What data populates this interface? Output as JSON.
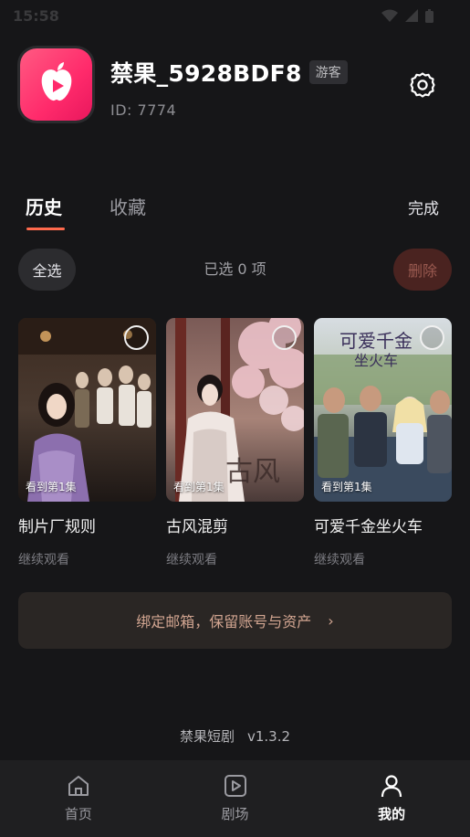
{
  "status_bar": {
    "time": "15:58"
  },
  "profile": {
    "username": "禁果_5928BDF8",
    "badge": "游客",
    "user_id": "ID:  7774"
  },
  "tabs": [
    {
      "label": "历史",
      "active": true
    },
    {
      "label": "收藏",
      "active": false
    }
  ],
  "done_label": "完成",
  "select_bar": {
    "select_all": "全选",
    "selected_count": "已选 0 项",
    "delete": "删除"
  },
  "cards": [
    {
      "title": "制片厂规则",
      "progress": "看到第1集",
      "subtitle": "继续观看"
    },
    {
      "title": "古风混剪",
      "progress": "看到第1集",
      "subtitle": "继续观看"
    },
    {
      "title": "可爱千金坐火车",
      "progress": "看到第1集",
      "subtitle": "继续观看"
    }
  ],
  "bind_email": {
    "label": "绑定邮箱，保留账号与资产",
    "arrow": "›"
  },
  "footer": {
    "app_name": "禁果短剧",
    "version": "v1.3.2"
  },
  "bottom_nav": [
    {
      "label": "首页",
      "icon": "home-icon",
      "active": false
    },
    {
      "label": "剧场",
      "icon": "play-square-icon",
      "active": false
    },
    {
      "label": "我的",
      "icon": "user-icon",
      "active": true
    }
  ],
  "colors": {
    "background": "#161618",
    "accent": "#ff6a4d",
    "app_icon": "#ff2a6b",
    "delete_bg": "#4a2320",
    "bind_text": "#d2a591"
  }
}
